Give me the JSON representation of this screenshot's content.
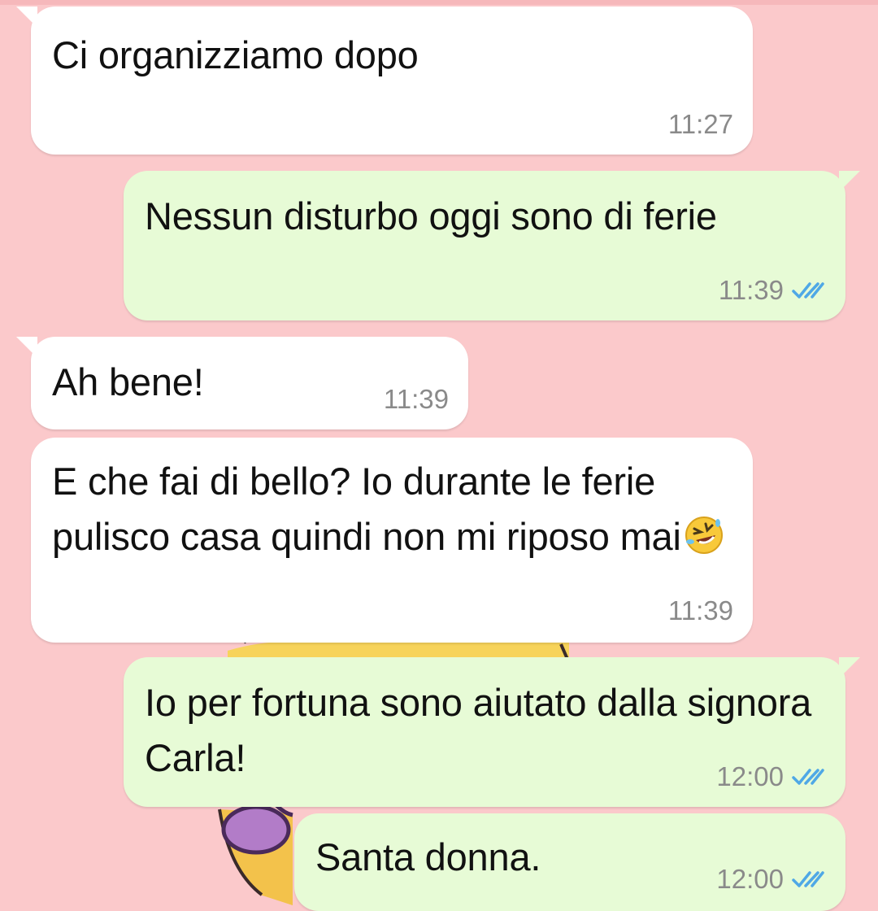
{
  "chat": {
    "messages": [
      {
        "direction": "incoming",
        "text": "Ci organizziamo dopo",
        "time": "11:27"
      },
      {
        "direction": "outgoing",
        "text": "Nessun disturbo oggi sono di ferie",
        "time": "11:39",
        "status": "read-double-check-icon"
      },
      {
        "direction": "incoming",
        "text": "Ah bene!",
        "time": "11:39"
      },
      {
        "direction": "incoming",
        "text": "E che fai di bello? Io durante le ferie pulisco casa quindi non mi riposo mai",
        "emoji": "rolling-on-floor-laughing-emoji",
        "time": "11:39"
      },
      {
        "direction": "outgoing",
        "text": "Io per fortuna sono aiutato dalla signora Carla!",
        "time": "12:00",
        "status": "read-double-check-icon"
      },
      {
        "direction": "outgoing",
        "text": "Santa donna.",
        "time": "12:00",
        "status": "read-double-check-icon"
      }
    ]
  },
  "colors": {
    "wallpaper": "#fbc9cb",
    "incoming_bubble": "#ffffff",
    "outgoing_bubble": "#e7fbd6",
    "read_ticks": "#4fa8e6",
    "timestamp": "#8a8a8a"
  }
}
